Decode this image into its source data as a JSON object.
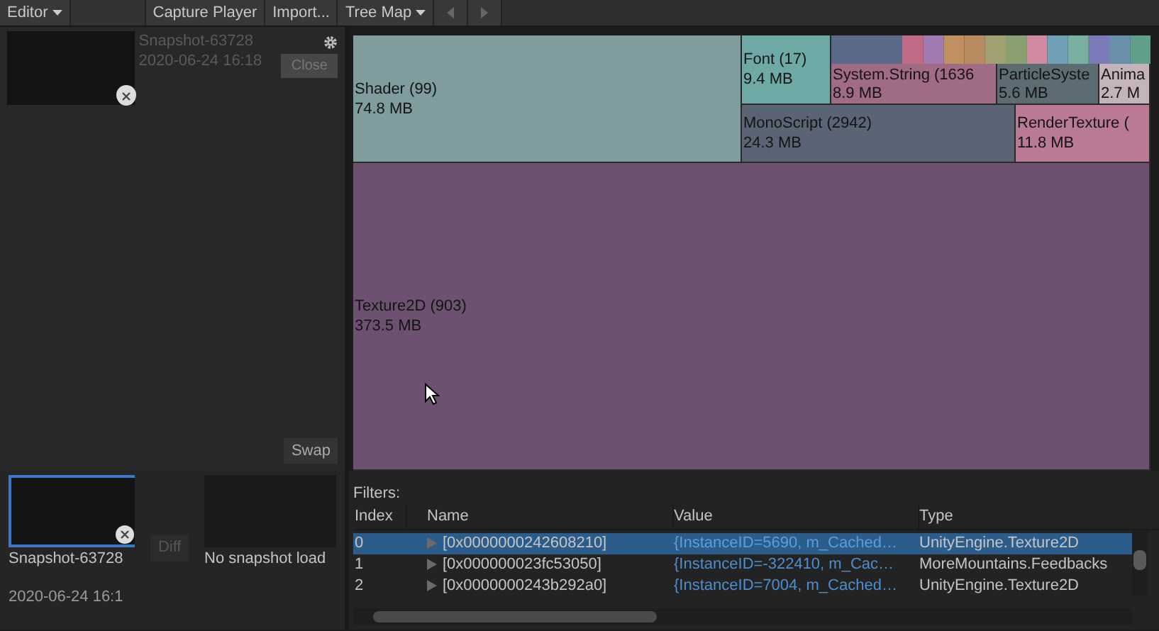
{
  "toolbar": {
    "editor_dropdown": "Editor",
    "buttons": [
      "Capture Player",
      "Import..."
    ],
    "view_dropdown": "Tree Map"
  },
  "snapshot_panel": {
    "name": "Snapshot-63728",
    "date": "2020-06-24 16:18",
    "close_button": "Close",
    "swap_button": "Swap"
  },
  "compare": {
    "snapshot_a": {
      "name": "Snapshot-63728",
      "date": "2020-06-24 16:1",
      "selected": true
    },
    "diff_button": {
      "label": "Diff",
      "disabled": true
    },
    "snapshot_b": {
      "label": "No snapshot load"
    }
  },
  "treemap": {
    "cells": [
      {
        "name": "Shader (99)",
        "size": "74.8 MB",
        "color": "#7f9c9e"
      },
      {
        "name": "Font (17)",
        "size": "9.4 MB",
        "color": "#6fa9a5"
      },
      {
        "name": "System.String (1636",
        "size": "8.9 MB",
        "color": "#a06c85"
      },
      {
        "name": "ParticleSyste",
        "size": "5.6 MB",
        "color": "#5d6b72"
      },
      {
        "name": "Anima",
        "size": "2.7 M",
        "color": "#c4b3bb"
      },
      {
        "name": "MonoScript (2942)",
        "size": "24.3 MB",
        "color": "#5b6474"
      },
      {
        "name": "RenderTexture (",
        "size": "11.8 MB",
        "color": "#b97b93"
      },
      {
        "name": "Texture2D (903)",
        "size": "373.5 MB",
        "color": "#6c5170"
      }
    ]
  },
  "table": {
    "filters_label": "Filters:",
    "columns": [
      "Index",
      "Name",
      "Value",
      "Type"
    ],
    "rows": [
      {
        "index": "0",
        "name": "[0x0000000242608210]",
        "value": "{InstanceID=5690, m_Cached…",
        "type": "UnityEngine.Texture2D",
        "selected": true
      },
      {
        "index": "1",
        "name": "[0x000000023fc53050]",
        "value": "{InstanceID=-322410, m_Cac…",
        "type": "MoreMountains.Feedbacks",
        "selected": false
      },
      {
        "index": "2",
        "name": "[0x0000000243b292a0]",
        "value": "{InstanceID=7004, m_Cached…",
        "type": "UnityEngine.Texture2D",
        "selected": false
      }
    ]
  }
}
